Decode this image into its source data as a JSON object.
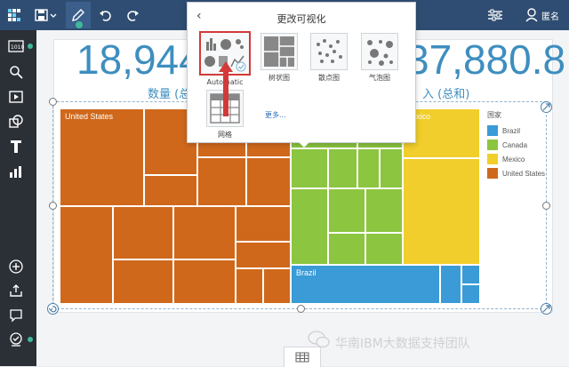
{
  "toolbar": {
    "user_label": "匿名"
  },
  "kpis": [
    {
      "value": "18,944",
      "label": "数量 (总"
    },
    {
      "value": "37,880.8",
      "label": "入 (总和)"
    }
  ],
  "treemap": {
    "regions": [
      {
        "label": "United States",
        "color": "#d0681b"
      },
      {
        "label": "Canada",
        "color": "#8cc540"
      },
      {
        "label": "Mexico",
        "color": "#f1ce2b"
      },
      {
        "label": "Brazil",
        "color": "#3a9bd6"
      }
    ],
    "visible_labels": {
      "us": "United States",
      "mexico_partial": "exico",
      "brazil": "Brazil"
    }
  },
  "legend": {
    "title": "国家",
    "items": [
      {
        "label": "Brazil",
        "color": "#3a9bd6"
      },
      {
        "label": "Canada",
        "color": "#8cc540"
      },
      {
        "label": "Mexico",
        "color": "#f1ce2b"
      },
      {
        "label": "United States",
        "color": "#d0681b"
      }
    ]
  },
  "popover": {
    "title": "更改可视化",
    "options": [
      {
        "label": "Automatic",
        "selected": true
      },
      {
        "label": "树状图"
      },
      {
        "label": "散点图"
      },
      {
        "label": "气泡图"
      },
      {
        "label": "网格"
      }
    ],
    "more_label": "更多..."
  },
  "watermark": "华南IBM大数据支持团队",
  "colors": {
    "topbar": "#2f4d72",
    "sidebar": "#2b2f36",
    "accent": "#3e8ebf",
    "selection_highlight": "#d23a3a"
  }
}
